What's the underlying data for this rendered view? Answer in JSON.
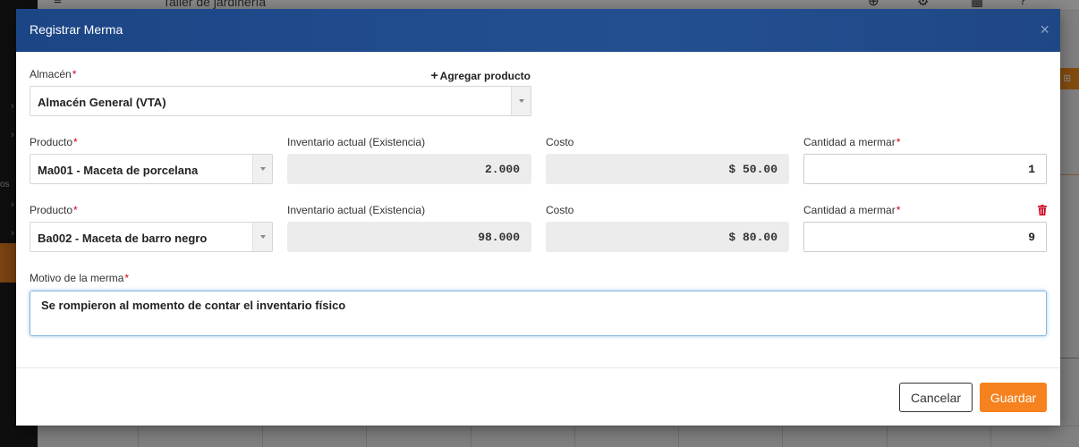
{
  "background": {
    "page_title": "Taller de jardinería"
  },
  "modal": {
    "title": "Registrar Merma",
    "close_symbol": "×",
    "add_product_label": "Agregar producto",
    "warehouse": {
      "label": "Almacén",
      "value": "Almacén General (VTA)"
    },
    "columns": {
      "product": "Producto",
      "stock": "Inventario actual (Existencia)",
      "cost": "Costo",
      "quantity": "Cantidad a mermar"
    },
    "rows": [
      {
        "product": "Ma001 - Maceta de porcelana",
        "stock": "2.000",
        "cost": "$ 50.00",
        "quantity": "1"
      },
      {
        "product": "Ba002 - Maceta de barro negro",
        "stock": "98.000",
        "cost": "$ 80.00",
        "quantity": "9"
      }
    ],
    "reason": {
      "label": "Motivo de la merma",
      "value": "Se rompieron al momento de contar el inventario físico"
    },
    "buttons": {
      "cancel": "Cancelar",
      "save": "Guardar"
    }
  },
  "colors": {
    "header": "#234f91",
    "primary_button": "#f5821f",
    "required": "#d0021b",
    "trash_icon": "#d0021b"
  },
  "icons": {
    "add": "plus-icon",
    "remove_row": "trash-icon",
    "close": "close-icon"
  }
}
